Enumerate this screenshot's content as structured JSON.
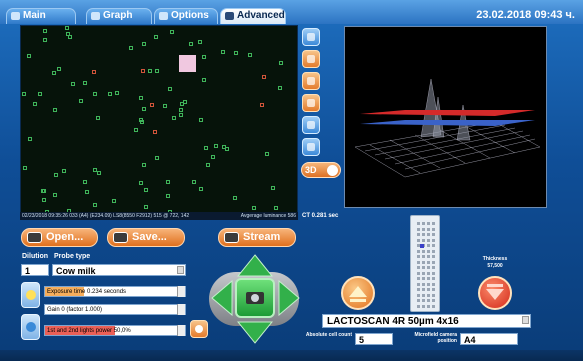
{
  "tabs": [
    {
      "label": "Main",
      "icon": "home-icon"
    },
    {
      "label": "Graph",
      "icon": "graph-icon"
    },
    {
      "label": "Options",
      "icon": "options-icon"
    },
    {
      "label": "Advanced",
      "icon": "advanced-icon",
      "active": true
    }
  ],
  "header": {
    "datetime": "23.02.2018 09:43 ч."
  },
  "image_view": {
    "status_left": "02/23/2018 09:35:26 033 (A4) (E234.09) LS8(8550 F2912) 515 @ 722, 142",
    "status_right": "Avgerage luminance 586"
  },
  "side_tools": [
    {
      "name": "cursor-tool-icon"
    },
    {
      "name": "zoom-tool-icon"
    },
    {
      "name": "grid-tool-icon"
    },
    {
      "name": "marker-tool-icon"
    },
    {
      "name": "pen-tool-icon"
    },
    {
      "name": "lens-tool-icon"
    }
  ],
  "toggle_3d": {
    "label": "3D",
    "state": "on"
  },
  "ct_text": "CT 0.281 sec",
  "file_buttons": {
    "open": "Open...",
    "save": "Save...",
    "stream": "Stream"
  },
  "dilution": {
    "label": "Dilution",
    "value": "1"
  },
  "probe": {
    "label": "Probe type",
    "value": "Cow milk"
  },
  "params": {
    "exposure": {
      "label": "Exposure time 0.234 seconds",
      "fill_percent": 28,
      "color": "#f5a040"
    },
    "gain": {
      "label": "Gain 0 (factor 1.000)",
      "fill_percent": 0,
      "color": "#f5a040"
    },
    "lights": {
      "label": "1st and 2nd lights power 50,0%",
      "fill_percent": 50,
      "color": "#e8443a"
    }
  },
  "thickness": {
    "label": "Thickness",
    "value": "57,500"
  },
  "device": {
    "value": "LACTOSCAN 4R 50µm 4x16"
  },
  "cell_count": {
    "label": "Absolute cell count",
    "value": "5"
  },
  "camera_position": {
    "label": "Microfield camera position",
    "value": "A4"
  },
  "colors": {
    "accent_orange": "#e0701e",
    "nav_green": "#2fae44",
    "background_blue": "#0f4e97"
  }
}
